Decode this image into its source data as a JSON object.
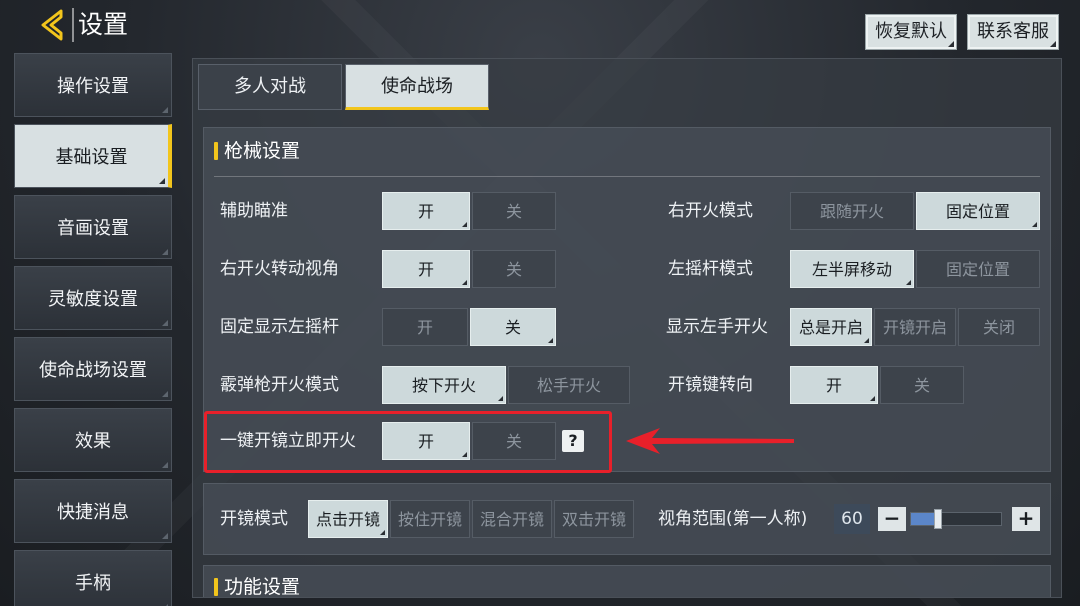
{
  "header": {
    "title": "设置",
    "restore_label": "恢复默认",
    "contact_label": "联系客服"
  },
  "sidebar": {
    "items": [
      {
        "label": "操作设置"
      },
      {
        "label": "基础设置",
        "active": true
      },
      {
        "label": "音画设置"
      },
      {
        "label": "灵敏度设置"
      },
      {
        "label": "使命战场设置"
      },
      {
        "label": "效果"
      },
      {
        "label": "快捷消息"
      },
      {
        "label": "手柄"
      }
    ]
  },
  "tabs": [
    {
      "label": "多人对战"
    },
    {
      "label": "使命战场",
      "active": true
    }
  ],
  "gun_settings": {
    "title": "枪械设置",
    "aim_assist": {
      "label": "辅助瞄准",
      "on": "开",
      "off": "关",
      "selected": "开"
    },
    "fire_rotate_view": {
      "label": "右开火转动视角",
      "on": "开",
      "off": "关",
      "selected": "开"
    },
    "fixed_left_stick": {
      "label": "固定显示左摇杆",
      "on": "开",
      "off": "关",
      "selected": "关"
    },
    "shotgun_fire_mode": {
      "label": "霰弹枪开火模式",
      "press": "按下开火",
      "release": "松手开火",
      "selected": "按下开火"
    },
    "one_key_scope_fire": {
      "label": "一键开镜立即开火",
      "on": "开",
      "off": "关",
      "selected": "开",
      "help": "?"
    },
    "right_fire_mode": {
      "label": "右开火模式",
      "follow": "跟随开火",
      "fixed": "固定位置",
      "selected": "固定位置"
    },
    "left_stick_mode": {
      "label": "左摇杆模式",
      "half_screen": "左半屏移动",
      "fixed": "固定位置",
      "selected": "左半屏移动"
    },
    "show_left_fire": {
      "label": "显示左手开火",
      "always": "总是开启",
      "scope": "开镜开启",
      "off": "关闭",
      "selected": "总是开启"
    },
    "scope_turn": {
      "label": "开镜键转向",
      "on": "开",
      "off": "关",
      "selected": "开"
    }
  },
  "scope_settings": {
    "mode": {
      "label": "开镜模式",
      "options": [
        "点击开镜",
        "按住开镜",
        "混合开镜",
        "双击开镜"
      ],
      "selected": "点击开镜"
    },
    "fov": {
      "label": "视角范围(第一人称)",
      "value": "60",
      "minus": "−",
      "plus": "+",
      "slider_fraction": 0.3
    }
  },
  "function_settings": {
    "title": "功能设置"
  },
  "colors": {
    "accent": "#f2c51c",
    "highlight": "#e8202a",
    "selected_bg": "#cdd9db",
    "slider_fill": "#5b86c9"
  }
}
